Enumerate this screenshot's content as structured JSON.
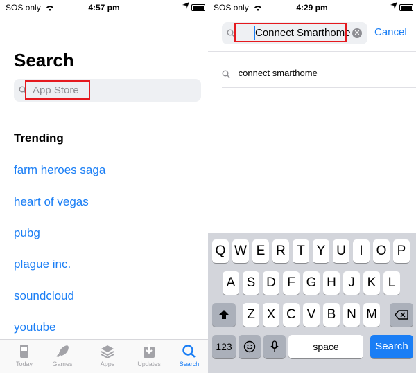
{
  "left": {
    "status": {
      "carrier": "SOS only",
      "time": "4:57 pm"
    },
    "title": "Search",
    "search_placeholder": "App Store",
    "trending_title": "Trending",
    "trending": [
      "farm heroes saga",
      "heart of vegas",
      "pubg",
      "plague inc.",
      "soundcloud",
      "youtube"
    ],
    "tabs": [
      {
        "label": "Today",
        "icon": "today-icon"
      },
      {
        "label": "Games",
        "icon": "rocket-icon"
      },
      {
        "label": "Apps",
        "icon": "layers-icon"
      },
      {
        "label": "Updates",
        "icon": "download-icon"
      },
      {
        "label": "Search",
        "icon": "search-icon",
        "active": true
      }
    ]
  },
  "right": {
    "status": {
      "carrier": "SOS only",
      "time": "4:29 pm"
    },
    "search_value": "Connect Smarthome",
    "cancel_label": "Cancel",
    "suggestion": "connect smarthome",
    "keyboard": {
      "row1": [
        "Q",
        "W",
        "E",
        "R",
        "T",
        "Y",
        "U",
        "I",
        "O",
        "P"
      ],
      "row2": [
        "A",
        "S",
        "D",
        "F",
        "G",
        "H",
        "J",
        "K",
        "L"
      ],
      "row3": [
        "Z",
        "X",
        "C",
        "V",
        "B",
        "N",
        "M"
      ],
      "numbers_label": "123",
      "space_label": "space",
      "search_label": "Search"
    }
  },
  "colors": {
    "accent": "#1a7ef5",
    "highlight": "#e5191e"
  }
}
